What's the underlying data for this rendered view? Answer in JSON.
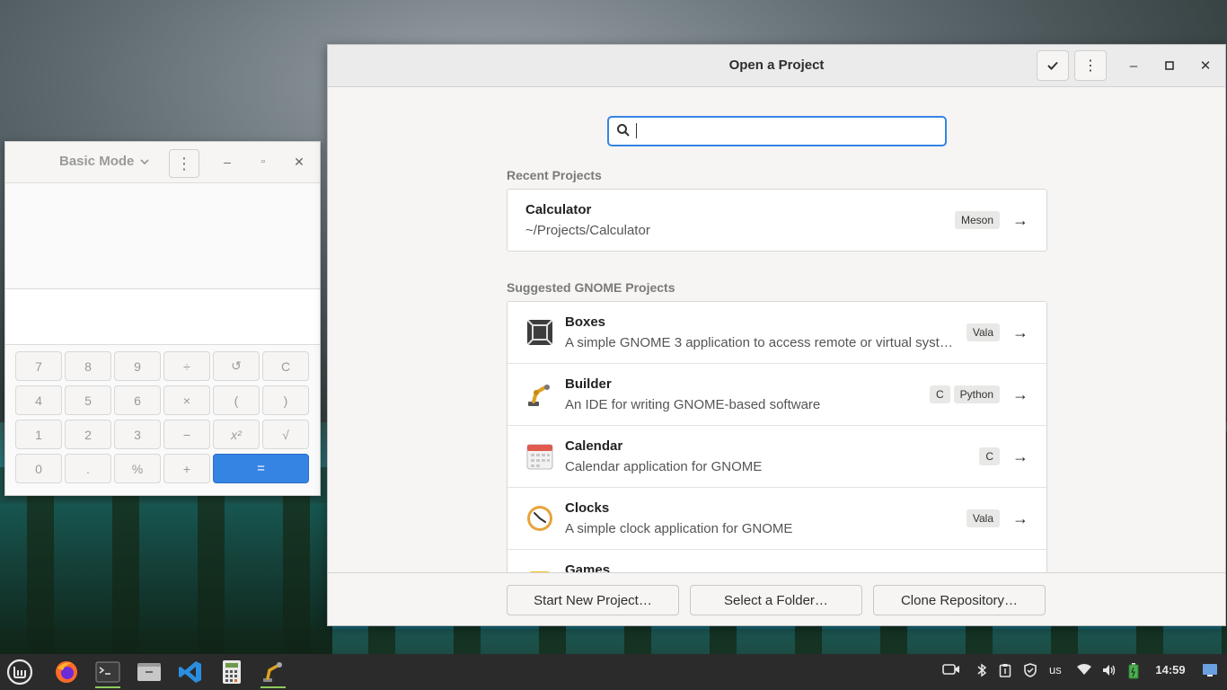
{
  "calculator": {
    "mode_label": "Basic Mode",
    "keys": [
      "7",
      "8",
      "9",
      "÷",
      "↺",
      "C",
      "4",
      "5",
      "6",
      "×",
      "(",
      ")",
      "1",
      "2",
      "3",
      "−",
      "x²",
      "√",
      "0",
      ".",
      "%",
      "+",
      "="
    ]
  },
  "builder": {
    "title": "Open a Project",
    "search_placeholder": "",
    "recent_title": "Recent Projects",
    "recent": [
      {
        "name": "Calculator",
        "path": "~/Projects/Calculator",
        "tags": [
          "Meson"
        ]
      }
    ],
    "suggested_title": "Suggested GNOME Projects",
    "suggested": [
      {
        "name": "Boxes",
        "desc": "A simple GNOME 3 application to access remote or virtual syst…",
        "tags": [
          "Vala"
        ],
        "icon": "boxes-icon"
      },
      {
        "name": "Builder",
        "desc": "An IDE for writing GNOME-based software",
        "tags": [
          "C",
          "Python"
        ],
        "icon": "builder-icon"
      },
      {
        "name": "Calendar",
        "desc": "Calendar application for GNOME",
        "tags": [
          "C"
        ],
        "icon": "calendar-icon"
      },
      {
        "name": "Clocks",
        "desc": "A simple clock application for GNOME",
        "tags": [
          "Vala"
        ],
        "icon": "clocks-icon"
      },
      {
        "name": "Games",
        "desc": "",
        "tags": [],
        "icon": "games-icon"
      }
    ],
    "footer": {
      "start_new": "Start New Project…",
      "select_folder": "Select a Folder…",
      "clone_repo": "Clone Repository…"
    }
  },
  "taskbar": {
    "keyboard_layout": "us",
    "clock": "14:59"
  },
  "colors": {
    "accent": "#3584e4",
    "window_bg": "#f6f5f4",
    "taskbar_bg": "#2b2b2b"
  }
}
